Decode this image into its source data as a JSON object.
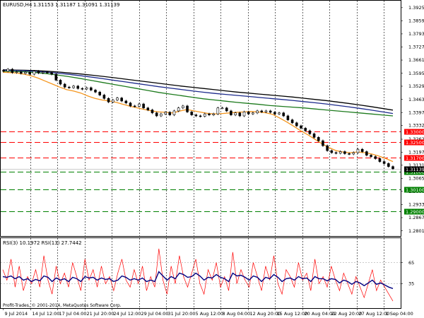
{
  "window": {
    "symbol_label": "EURUSD,H4",
    "ohlc_values": "1.31153 1.31187 1.31091 1.31139"
  },
  "indicator": {
    "label": "RSI(3) 10.1972 RSI(13) 27.7442",
    "levels": [
      "65",
      "35"
    ],
    "level_values": [
      65,
      35
    ]
  },
  "footer": {
    "copyright": "Profit-Trades, © 2001-2014, MetaQuotes Software Corp."
  },
  "colors": {
    "candle": "#000000",
    "ma_fast": "#f5961e",
    "ma_mid": "#1c7a1c",
    "ma_slow1": "#1c2a8c",
    "ma_slow2": "#000000",
    "resistance": "#ff0000",
    "support": "#008000",
    "rsi_fast": "#ff0000",
    "rsi_slow": "#000080",
    "current_price_tag": "#000000"
  },
  "chart_data": {
    "type": "candlestick",
    "symbol": "EURUSD",
    "timeframe": "H4",
    "y_ticks": [
      "1.39250",
      "1.38590",
      "1.37930",
      "1.37270",
      "1.36610",
      "1.35950",
      "1.35295",
      "1.34630",
      "1.33970",
      "1.33320",
      "1.32625",
      "1.31975",
      "1.31315",
      "1.30655",
      "1.30000",
      "1.29335",
      "1.28675",
      "1.28015"
    ],
    "y_tick_values": [
      1.3925,
      1.3859,
      1.3793,
      1.3727,
      1.3661,
      1.3595,
      1.35295,
      1.3463,
      1.3397,
      1.3332,
      1.32625,
      1.31975,
      1.31315,
      1.30655,
      1.3,
      1.29335,
      1.28675,
      1.28015
    ],
    "x_ticks": [
      "9 Jul 2014",
      "14 Jul 12:00",
      "17 Jul 04:00",
      "21 Jul 20:00",
      "24 Jul 12:00",
      "29 Jul 04:00",
      "31 Jul 20:00",
      "5 Aug 12:00",
      "8 Aug 04:00",
      "12 Aug 20:00",
      "15 Aug 12:00",
      "20 Aug 04:00",
      "22 Aug 20:00",
      "27 Aug 12:00",
      "1 Sep 04:00"
    ],
    "ylim": [
      1.2775,
      1.396
    ],
    "horizontal_levels": [
      {
        "label": "1.33000",
        "value": 1.33,
        "style": "resistance"
      },
      {
        "label": "1.32500",
        "value": 1.325,
        "style": "resistance"
      },
      {
        "label": "1.31700",
        "value": 1.317,
        "style": "resistance"
      },
      {
        "label": "1.31000",
        "value": 1.31,
        "style": "support"
      },
      {
        "label": "1.30100",
        "value": 1.301,
        "style": "support"
      },
      {
        "label": "1.29000",
        "value": 1.29,
        "style": "support"
      }
    ],
    "current_price": {
      "label": "1.31139",
      "value": 1.31139
    },
    "price_path": [
      1.3605,
      1.3615,
      1.3598,
      1.3602,
      1.3594,
      1.36,
      1.359,
      1.3605,
      1.3596,
      1.36,
      1.3598,
      1.359,
      1.356,
      1.354,
      1.3525,
      1.3522,
      1.353,
      1.3518,
      1.3515,
      1.3522,
      1.351,
      1.35,
      1.3485,
      1.3468,
      1.345,
      1.346,
      1.347,
      1.3455,
      1.3445,
      1.343,
      1.3428,
      1.344,
      1.342,
      1.341,
      1.3395,
      1.338,
      1.339,
      1.3398,
      1.3385,
      1.3405,
      1.342,
      1.343,
      1.34,
      1.3385,
      1.338,
      1.3378,
      1.339,
      1.3385,
      1.339,
      1.342,
      1.342,
      1.3405,
      1.3385,
      1.3395,
      1.338,
      1.34,
      1.339,
      1.3395,
      1.3405,
      1.34,
      1.3405,
      1.3398,
      1.339,
      1.3395,
      1.338,
      1.336,
      1.3345,
      1.333,
      1.3318,
      1.3305,
      1.329,
      1.3272,
      1.3255,
      1.323,
      1.3205,
      1.3195,
      1.3192,
      1.32,
      1.319,
      1.3188,
      1.3195,
      1.3212,
      1.32,
      1.3182,
      1.3175,
      1.3165,
      1.315,
      1.314,
      1.3125,
      1.31139
    ],
    "ma_fast": [
      1.36,
      1.3598,
      1.3596,
      1.359,
      1.3582,
      1.357,
      1.3555,
      1.354,
      1.3525,
      1.3512,
      1.3505,
      1.3495,
      1.348,
      1.3468,
      1.346,
      1.3455,
      1.3448,
      1.3438,
      1.3428,
      1.342,
      1.3412,
      1.3405,
      1.34,
      1.3398,
      1.3395,
      1.3405,
      1.3412,
      1.3405,
      1.3398,
      1.3392,
      1.339,
      1.3392,
      1.3395,
      1.3398,
      1.34,
      1.3402,
      1.34,
      1.3396,
      1.3388,
      1.337,
      1.335,
      1.3328,
      1.3305,
      1.3285,
      1.3262,
      1.324,
      1.322,
      1.3205,
      1.3198,
      1.3195,
      1.3198,
      1.3195,
      1.3188,
      1.3178,
      1.3165,
      1.315
    ],
    "ma_mid": [
      1.3605,
      1.3604,
      1.3602,
      1.3598,
      1.3592,
      1.3585,
      1.3577,
      1.3568,
      1.3558,
      1.3548,
      1.3538,
      1.3528,
      1.3518,
      1.3508,
      1.3498,
      1.349,
      1.3482,
      1.3474,
      1.3466,
      1.346,
      1.3454,
      1.3448,
      1.3443,
      1.3438,
      1.3432,
      1.3428,
      1.3424,
      1.342,
      1.3415,
      1.341,
      1.3405,
      1.34,
      1.3395,
      1.339,
      1.3385,
      1.338
    ],
    "ma_slow1": [
      1.361,
      1.3609,
      1.3607,
      1.3604,
      1.36,
      1.3595,
      1.3589,
      1.3582,
      1.3575,
      1.3567,
      1.3559,
      1.3551,
      1.3543,
      1.3535,
      1.3527,
      1.352,
      1.3513,
      1.3506,
      1.3499,
      1.3493,
      1.3488,
      1.3483,
      1.3478,
      1.3473,
      1.3468,
      1.3463,
      1.3458,
      1.3452,
      1.3446,
      1.344,
      1.3433,
      1.3426,
      1.3418,
      1.341,
      1.3401,
      1.3392
    ],
    "ma_slow2": [
      1.3612,
      1.3611,
      1.361,
      1.3608,
      1.3605,
      1.3601,
      1.3596,
      1.3591,
      1.3585,
      1.3579,
      1.3572,
      1.3565,
      1.3558,
      1.3551,
      1.3544,
      1.3537,
      1.353,
      1.3524,
      1.3518,
      1.3512,
      1.3506,
      1.35,
      1.3495,
      1.349,
      1.3485,
      1.348,
      1.3475,
      1.3469,
      1.3463,
      1.3457,
      1.345,
      1.3443,
      1.3435,
      1.3427,
      1.3418,
      1.3409
    ],
    "rsi_fast": [
      55,
      40,
      70,
      30,
      60,
      25,
      45,
      35,
      55,
      30,
      75,
      40,
      20,
      60,
      35,
      50,
      30,
      65,
      45,
      25,
      70,
      40,
      55,
      30,
      60,
      35,
      45,
      25,
      50,
      70,
      40,
      30,
      55,
      35,
      60,
      25,
      45,
      30,
      85,
      40,
      20,
      60,
      35,
      75,
      45,
      30,
      50,
      70,
      35,
      20,
      55,
      40,
      65,
      30,
      45,
      25,
      80,
      35,
      55,
      40,
      30,
      65,
      45,
      25,
      60,
      40,
      75,
      35,
      20,
      55,
      45,
      30,
      65,
      40,
      50,
      25,
      70,
      35,
      45,
      30,
      60,
      40,
      25,
      50,
      35,
      20,
      45,
      30,
      15,
      35,
      55,
      25,
      40,
      30,
      20,
      10
    ],
    "rsi_slow": [
      45,
      44,
      46,
      42,
      45,
      40,
      42,
      38,
      41,
      39,
      46,
      44,
      38,
      43,
      40,
      42,
      38,
      44,
      42,
      38,
      45,
      43,
      44,
      40,
      43,
      41,
      42,
      38,
      40,
      46,
      44,
      40,
      42,
      40,
      43,
      38,
      40,
      38,
      52,
      46,
      40,
      45,
      42,
      50,
      48,
      44,
      45,
      50,
      46,
      40,
      44,
      43,
      48,
      44,
      42,
      38,
      50,
      46,
      47,
      44,
      40,
      46,
      44,
      38,
      44,
      42,
      48,
      44,
      38,
      42,
      43,
      40,
      45,
      42,
      43,
      38,
      45,
      42,
      42,
      39,
      42,
      41,
      36,
      40,
      38,
      34,
      38,
      36,
      32,
      36,
      40,
      34,
      36,
      33,
      30,
      28
    ],
    "rsi_ylim": [
      0,
      100
    ]
  }
}
